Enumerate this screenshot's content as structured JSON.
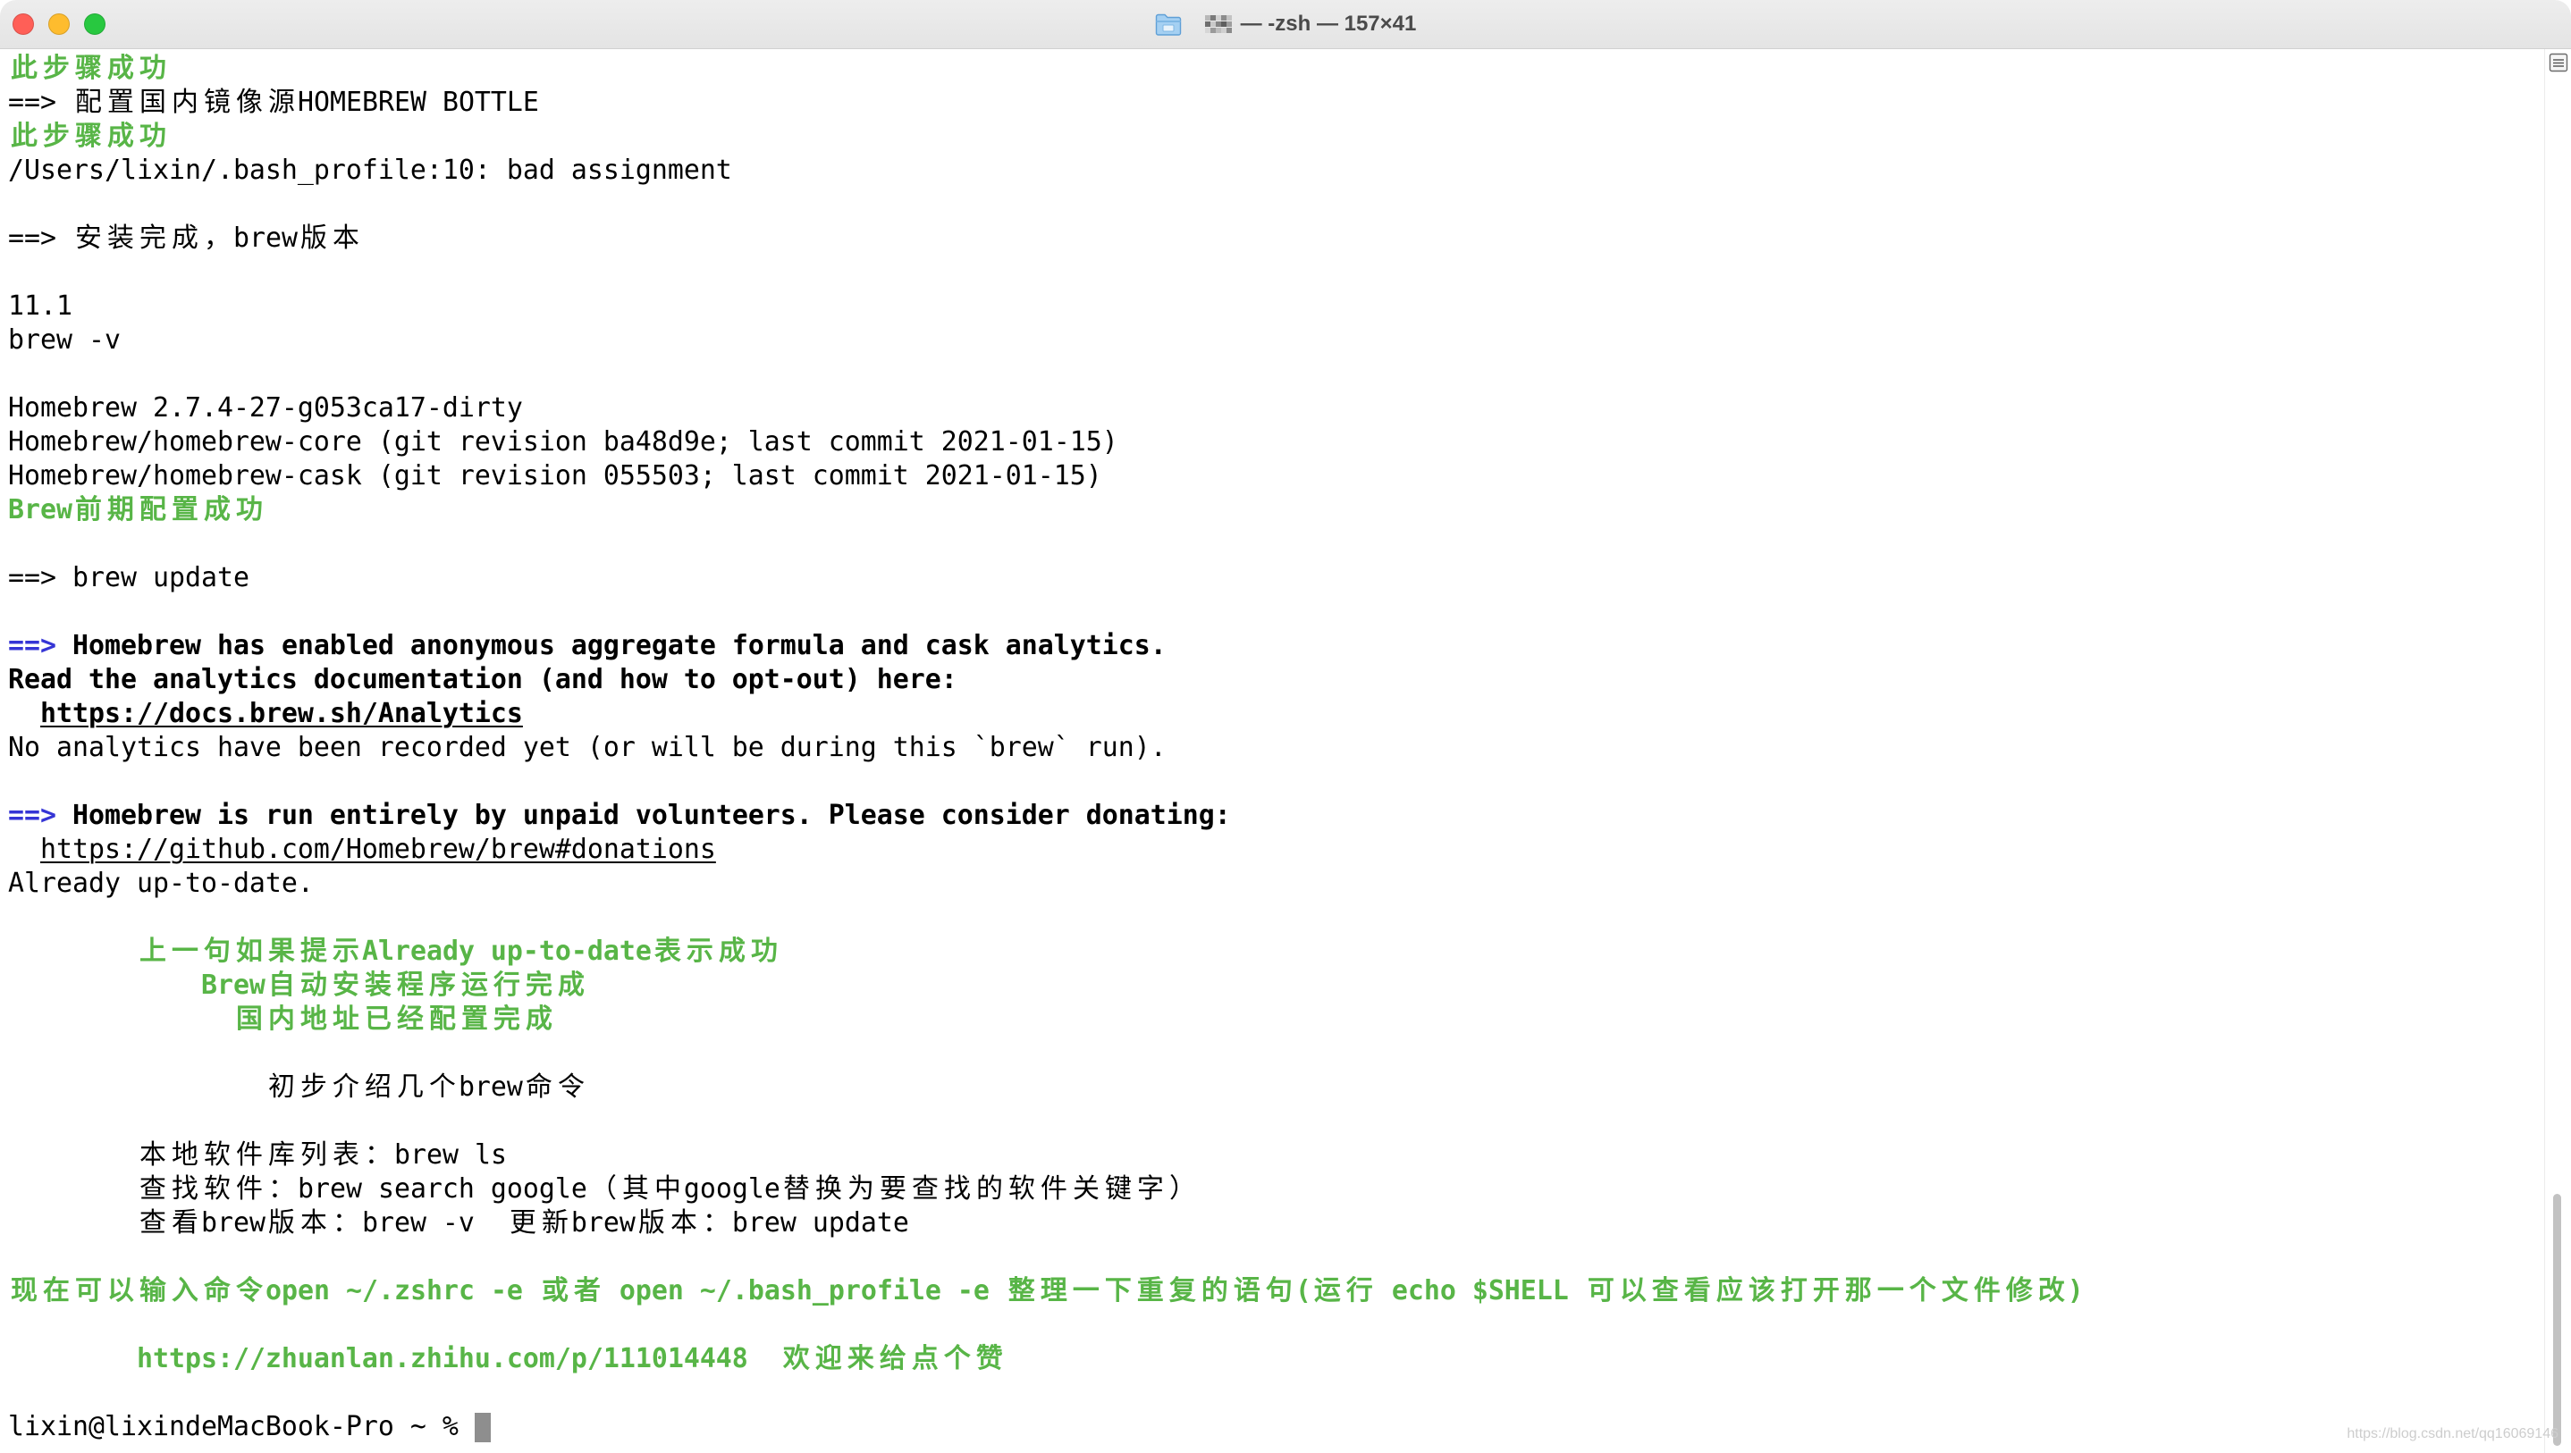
{
  "window": {
    "title": "— -zsh — 157×41",
    "proxy_icon": "folder-icon",
    "redacted_icon": "pixelated-mosaic",
    "controls": {
      "close_color": "#ff5f57",
      "minimize_color": "#febc2e",
      "zoom_color": "#28c840"
    }
  },
  "colors": {
    "background": "#ffffff",
    "text": "#000000",
    "green": "#58b547",
    "blue": "#3535d5",
    "cursor": "#8e8e8e"
  },
  "terminal": {
    "lines": [
      {
        "segments": [
          {
            "text": "此步骤成功",
            "bold": true,
            "color": "green"
          }
        ]
      },
      {
        "segments": [
          {
            "text": "==> 配置国内镜像源HOMEBREW BOTTLE"
          }
        ]
      },
      {
        "segments": [
          {
            "text": "此步骤成功",
            "bold": true,
            "color": "green"
          }
        ]
      },
      {
        "segments": [
          {
            "text": "/Users/lixin/.bash_profile:10: bad assignment"
          }
        ]
      },
      {
        "segments": []
      },
      {
        "segments": [
          {
            "text": "==> 安装完成，brew版本"
          }
        ]
      },
      {
        "segments": []
      },
      {
        "segments": [
          {
            "text": "11.1"
          }
        ]
      },
      {
        "segments": [
          {
            "text": "brew -v"
          }
        ]
      },
      {
        "segments": []
      },
      {
        "segments": [
          {
            "text": "Homebrew 2.7.4-27-g053ca17-dirty"
          }
        ]
      },
      {
        "segments": [
          {
            "text": "Homebrew/homebrew-core (git revision ba48d9e; last commit 2021-01-15)"
          }
        ]
      },
      {
        "segments": [
          {
            "text": "Homebrew/homebrew-cask (git revision 055503; last commit 2021-01-15)"
          }
        ]
      },
      {
        "segments": [
          {
            "text": "Brew前期配置成功",
            "bold": true,
            "color": "green"
          }
        ]
      },
      {
        "segments": []
      },
      {
        "segments": [
          {
            "text": "==> brew update"
          }
        ]
      },
      {
        "segments": []
      },
      {
        "segments": [
          {
            "text": "==>",
            "bold": true,
            "color": "blue"
          },
          {
            "text": " Homebrew has enabled anonymous aggregate formula and cask analytics.",
            "bold": true
          }
        ]
      },
      {
        "segments": [
          {
            "text": "Read the analytics documentation (and how to opt-out) here:",
            "bold": true
          }
        ]
      },
      {
        "segments": [
          {
            "text": "  ",
            "bold": true
          },
          {
            "text": "https://docs.brew.sh/Analytics",
            "bold": true,
            "underline": true,
            "link": true
          }
        ]
      },
      {
        "segments": [
          {
            "text": "No analytics have been recorded yet (or will be during this `brew` run)."
          }
        ]
      },
      {
        "segments": []
      },
      {
        "segments": [
          {
            "text": "==>",
            "bold": true,
            "color": "blue"
          },
          {
            "text": " Homebrew is run entirely by unpaid volunteers. Please consider donating:",
            "bold": true
          }
        ]
      },
      {
        "segments": [
          {
            "text": "  "
          },
          {
            "text": "https://github.com/Homebrew/brew#donations",
            "underline": true,
            "link": true
          }
        ]
      },
      {
        "segments": [
          {
            "text": "Already up-to-date."
          }
        ]
      },
      {
        "segments": []
      },
      {
        "segments": [
          {
            "text": "        上一句如果提示Already up-to-date表示成功",
            "bold": true,
            "color": "green"
          }
        ]
      },
      {
        "segments": [
          {
            "text": "            Brew自动安装程序运行完成",
            "bold": true,
            "color": "green"
          }
        ]
      },
      {
        "segments": [
          {
            "text": "              国内地址已经配置完成",
            "bold": true,
            "color": "green"
          }
        ]
      },
      {
        "segments": []
      },
      {
        "segments": [
          {
            "text": "                初步介绍几个brew命令"
          }
        ]
      },
      {
        "segments": []
      },
      {
        "segments": [
          {
            "text": "        本地软件库列表：brew ls"
          }
        ]
      },
      {
        "segments": [
          {
            "text": "        查找软件：brew search google（其中google替换为要查找的软件关键字）"
          }
        ]
      },
      {
        "segments": [
          {
            "text": "        查看brew版本：brew -v  更新brew版本：brew update"
          }
        ]
      },
      {
        "segments": []
      },
      {
        "segments": [
          {
            "text": "现在可以输入命令open ~/.zshrc -e 或者 open ~/.bash_profile -e 整理一下重复的语句(运行 echo $SHELL 可以查看应该打开那一个文件修改)",
            "bold": true,
            "color": "green"
          }
        ]
      },
      {
        "segments": []
      },
      {
        "segments": [
          {
            "text": "        https://zhuanlan.zhihu.com/p/111014448  欢迎来给点个赞",
            "bold": true,
            "color": "green"
          }
        ]
      },
      {
        "segments": []
      }
    ],
    "prompt": "lixin@lixindeMacBook-Pro ~ % ",
    "cursor_style": "block"
  },
  "scrollbar": {
    "position": 1.0,
    "visible_fraction": 0.185,
    "split_icon": "split-pane-icon"
  },
  "watermark": {
    "text": "https://blog.csdn.net/qq16069146"
  }
}
